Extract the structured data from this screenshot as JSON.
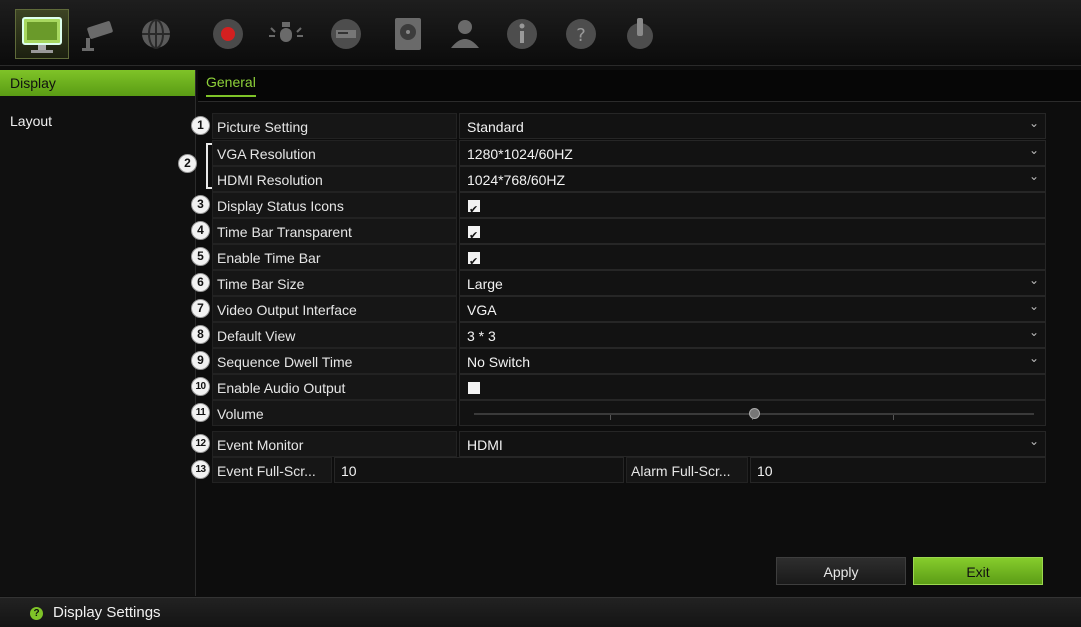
{
  "toolbar": {
    "icons": [
      "display-icon",
      "camera-icon",
      "network-icon",
      "record-icon",
      "alarm-icon",
      "device-icon",
      "hdd-icon",
      "user-icon",
      "info-icon",
      "help-icon",
      "power-icon"
    ]
  },
  "sidebar": {
    "items": [
      {
        "label": "Display",
        "active": true
      },
      {
        "label": "Layout",
        "active": false
      }
    ]
  },
  "tabs": [
    {
      "label": "General",
      "active": true
    }
  ],
  "form": {
    "rows": [
      {
        "num": "1",
        "label": "Picture Setting",
        "value": "Standard"
      },
      {
        "num": "2",
        "label": "VGA Resolution",
        "value": "1280*1024/60HZ"
      },
      {
        "label": "HDMI Resolution",
        "value": "1024*768/60HZ"
      },
      {
        "num": "3",
        "label": "Display Status Icons",
        "checked": true
      },
      {
        "num": "4",
        "label": "Time Bar Transparent",
        "checked": true
      },
      {
        "num": "5",
        "label": "Enable Time Bar",
        "checked": true
      },
      {
        "num": "6",
        "label": "Time Bar Size",
        "value": "Large"
      },
      {
        "num": "7",
        "label": "Video Output Interface",
        "value": "VGA"
      },
      {
        "num": "8",
        "label": "Default View",
        "value": "3 * 3"
      },
      {
        "num": "9",
        "label": "Sequence Dwell Time",
        "value": "No Switch"
      },
      {
        "num": "10",
        "label": "Enable Audio Output",
        "checked": false
      },
      {
        "num": "11",
        "label": "Volume",
        "level": 0.5
      },
      {
        "num": "12",
        "label": "Event Monitor",
        "value": "HDMI"
      },
      {
        "num": "13",
        "label": "Event Full-Scr...",
        "value": "10",
        "label2": "Alarm Full-Scr...",
        "value2": "10"
      }
    ]
  },
  "buttons": {
    "apply": "Apply",
    "exit": "Exit"
  },
  "status": {
    "text": "Display Settings",
    "icon": "help-icon"
  },
  "colors": {
    "accent": "#7fc328",
    "background": "#0d0d0d"
  }
}
